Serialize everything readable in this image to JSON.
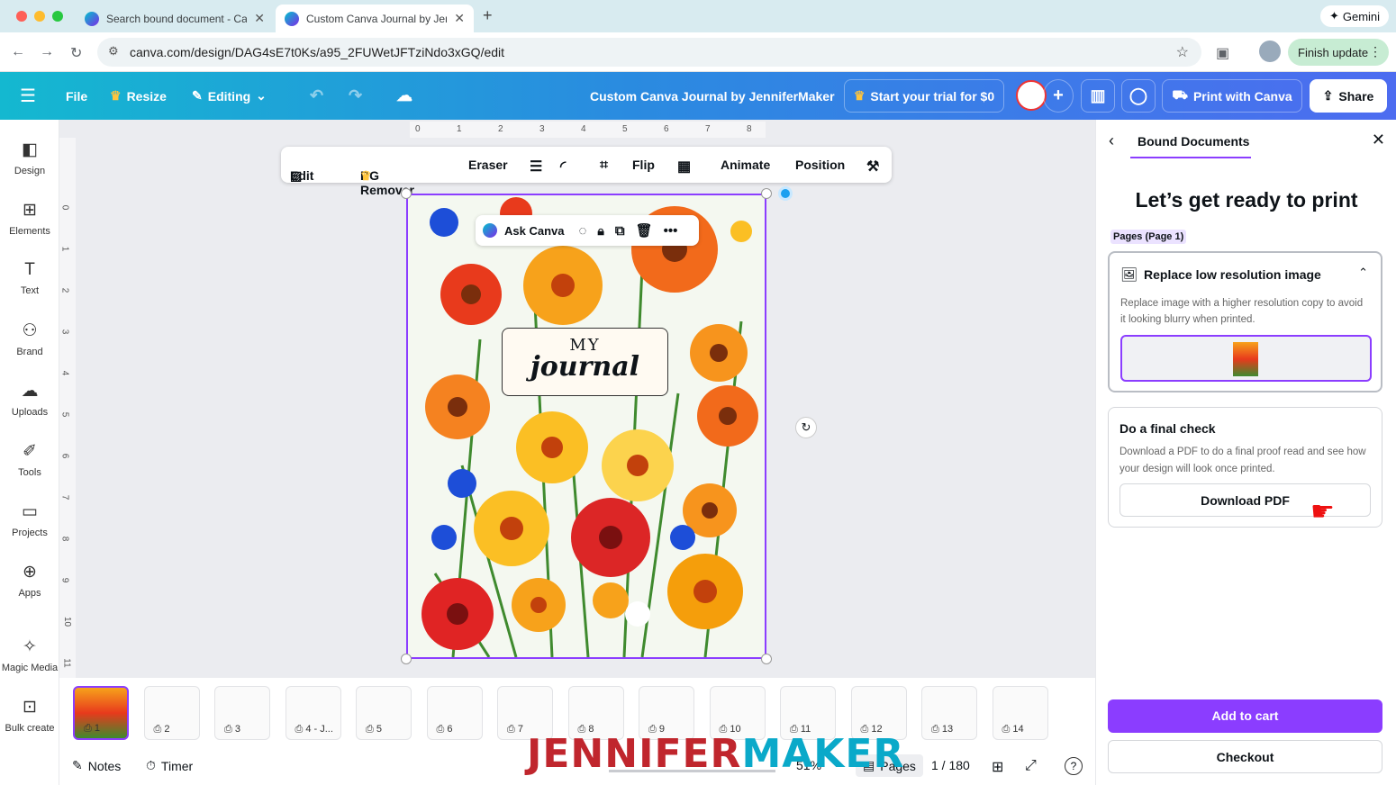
{
  "browser": {
    "tabs": [
      {
        "title": "Search bound document - Ca"
      },
      {
        "title": "Custom Canva Journal by Jer"
      }
    ],
    "new_tab": "+",
    "url": "canva.com/design/DAG4sE7t0Ks/a95_2FUWetJFTziNdo3xGQ/edit",
    "gemini": "Gemini",
    "finish_update": "Finish update"
  },
  "toolbar": {
    "file": "File",
    "resize": "Resize",
    "editing": "Editing",
    "doc_title": "Custom Canva Journal by JenniferMaker",
    "trial": "Start your trial for $0",
    "print": "Print with Canva",
    "share": "Share"
  },
  "sidebar": {
    "items": [
      {
        "label": "Design",
        "icon": "design-icon"
      },
      {
        "label": "Elements",
        "icon": "elements-icon"
      },
      {
        "label": "Text",
        "icon": "text-icon"
      },
      {
        "label": "Brand",
        "icon": "brand-icon"
      },
      {
        "label": "Uploads",
        "icon": "uploads-icon"
      },
      {
        "label": "Tools",
        "icon": "tools-icon"
      },
      {
        "label": "Projects",
        "icon": "projects-icon"
      },
      {
        "label": "Apps",
        "icon": "apps-icon"
      },
      {
        "label": "Magic Media",
        "icon": "magic-media-icon"
      },
      {
        "label": "Bulk create",
        "icon": "bulk-create-icon"
      }
    ]
  },
  "ruler": {
    "top": [
      "0",
      "1",
      "2",
      "3",
      "4",
      "5",
      "6",
      "7",
      "8"
    ],
    "left": [
      "0",
      "1",
      "2",
      "3",
      "4",
      "5",
      "6",
      "7",
      "8",
      "9",
      "10",
      "11"
    ]
  },
  "context_toolbar": {
    "edit": "Edit",
    "bg_remover": "BG Remover",
    "eraser": "Eraser",
    "flip": "Flip",
    "animate": "Animate",
    "position": "Position"
  },
  "ask_canva": "Ask Canva",
  "journal": {
    "line1": "MY",
    "line2": "journal"
  },
  "panel": {
    "tab": "Bound Documents",
    "heading": "Let’s get ready to print",
    "pages_badge": "Pages (Page 1)",
    "card1_title": "Replace low resolution image",
    "card1_desc": "Replace image with a higher resolution copy to avoid it looking blurry when printed.",
    "card2_title": "Do a final check",
    "card2_desc": "Download a PDF to do a final proof read and see how your design will look once printed.",
    "download": "Download PDF",
    "add_to_cart": "Add to cart",
    "checkout": "Checkout"
  },
  "pages": [
    "1",
    "2",
    "3",
    "4 - J...",
    "5",
    "6",
    "7",
    "8",
    "9",
    "10",
    "11",
    "12",
    "13",
    "14"
  ],
  "bottom": {
    "notes": "Notes",
    "timer": "Timer",
    "zoom": "51%",
    "pages_label": "Pages",
    "page_count": "1 / 180",
    "help": "?"
  },
  "watermark": {
    "part1": "JENNIFER",
    "part2": "MAKER"
  },
  "colors": {
    "accent": "#8b3dff",
    "topbar_start": "#14b8d0",
    "topbar_end": "#4d6cf0"
  }
}
